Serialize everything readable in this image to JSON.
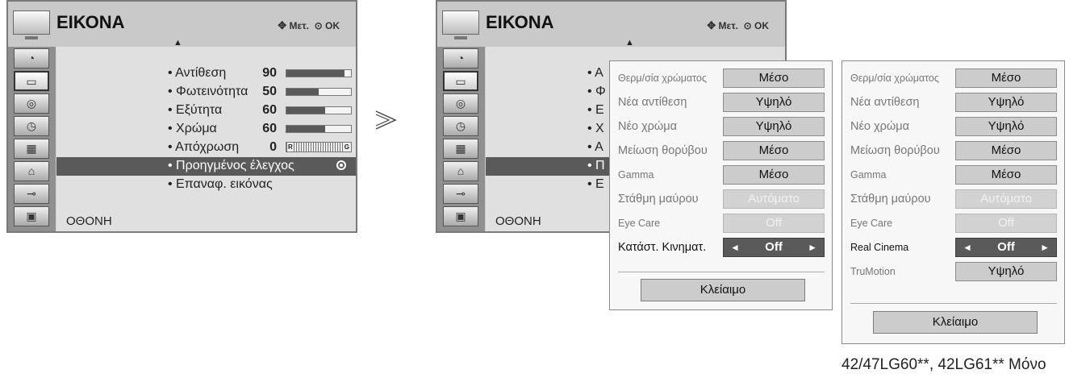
{
  "menu": {
    "title": "ΕΙΚΟΝΑ",
    "hint": "Μετ.",
    "ok": "OK",
    "footer": "ΟΘΟΝΗ",
    "sidebar_icons": [
      "satellite-dish-icon",
      "tv-screen-icon",
      "speaker-icon",
      "clock-icon",
      "lock-grid-icon",
      "padlock-icon",
      "connector-icon",
      "photo-icon"
    ],
    "items": [
      {
        "label": "• Αντίθεση",
        "value": "90",
        "level": 0.9
      },
      {
        "label": "• Φωτεινότητα",
        "value": "50",
        "level": 0.5
      },
      {
        "label": "• Εξύτητα",
        "value": "60",
        "level": 0.6
      },
      {
        "label": "• Χρώμα",
        "value": "60",
        "level": 0.6
      },
      {
        "label": "• Απόχρωση",
        "value": "0",
        "r": "R",
        "g": "G"
      },
      {
        "label": "• Προηγμένος έλεγχος"
      },
      {
        "label": "• Επαναφ. εικόνας"
      }
    ],
    "items_truncated": [
      "• Α",
      "• Φ",
      "• Ε",
      "• Χ",
      "• Α",
      "• Π",
      "• Ε"
    ]
  },
  "panel1": {
    "rows": [
      {
        "label": "Θερμ/σία χρώματος",
        "value": "Μέσο"
      },
      {
        "label": "Νέα αντίθεση",
        "value": "Υψηλό"
      },
      {
        "label": "Νέο χρώμα",
        "value": "Υψηλό"
      },
      {
        "label": "Μείωση θορύβου",
        "value": "Μέσο"
      },
      {
        "label": "Gamma",
        "value": "Μέσο"
      },
      {
        "label": "Στάθμη μαύρου",
        "value": "Αυτόματο"
      },
      {
        "label": "Eye Care",
        "value": "Off"
      },
      {
        "label": "Κατάστ. Κινηματ.",
        "value": "Off"
      }
    ],
    "close": "Κλείαιμο"
  },
  "panel2": {
    "rows": [
      {
        "label": "Θερμ/σία χρώματος",
        "value": "Μέσο"
      },
      {
        "label": "Νέα αντίθεση",
        "value": "Υψηλό"
      },
      {
        "label": "Νέο χρώμα",
        "value": "Υψηλό"
      },
      {
        "label": "Μείωση θορύβου",
        "value": "Μέσο"
      },
      {
        "label": "Gamma",
        "value": "Μέσο"
      },
      {
        "label": "Στάθμη μαύρου",
        "value": "Αυτόματο"
      },
      {
        "label": "Eye Care",
        "value": "Off"
      },
      {
        "label": "Real Cinema",
        "value": "Off"
      },
      {
        "label": "TruMotion",
        "value": "Υψηλό"
      }
    ],
    "close": "Κλείαιμο"
  },
  "arrows": {
    "left": "◄",
    "right": "►",
    "up": "▲"
  },
  "note": "42/47LG60**, 42LG61** Μόνο",
  "colors": {
    "highlight": "#5a5a5a",
    "menu_bg": "#e0e0e0",
    "sidebar": "#8f8f8f"
  }
}
